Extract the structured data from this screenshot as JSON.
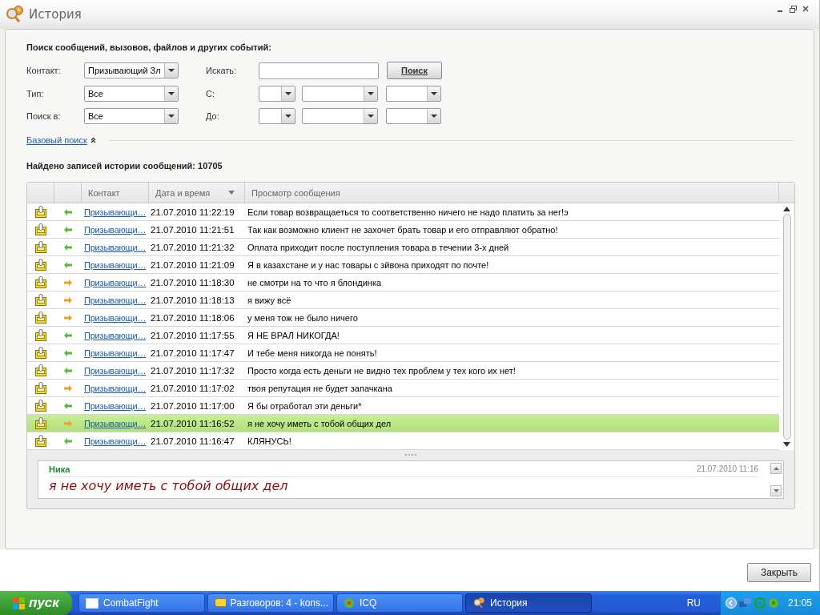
{
  "window": {
    "title": "История"
  },
  "search": {
    "heading": "Поиск сообщений, вызовов, файлов и других событий:",
    "contact_label": "Контакт:",
    "contact_value": "Призывающий Зл",
    "find_label": "Искать:",
    "find_button": "Поиск",
    "type_label": "Тип:",
    "type_value": "Все",
    "from_label": "С:",
    "to_label": "До:",
    "search_in_label": "Поиск в:",
    "search_in_value": "Все",
    "basic_search_link": "Базовый поиск"
  },
  "found_text": "Найдено записей истории сообщений: 10705",
  "table": {
    "columns": [
      "Контакт",
      "Дата и время",
      "Просмотр сообщения"
    ],
    "rows": [
      {
        "kind": "incoming",
        "contact": "Призывающи…",
        "datetime": "21.07.2010 11:22:19",
        "message": "Если товар возвращаеться то соответственно ничего не надо платить за нег!э",
        "selected": false
      },
      {
        "kind": "incoming",
        "contact": "Призывающи…",
        "datetime": "21.07.2010 11:21:51",
        "message": "Так как возможно клиент не захочет брать товар и его отправляют обратно!",
        "selected": false
      },
      {
        "kind": "incoming",
        "contact": "Призывающи…",
        "datetime": "21.07.2010 11:21:32",
        "message": "Оплата приходит после поступления товара в течении 3-х дней",
        "selected": false
      },
      {
        "kind": "incoming",
        "contact": "Призывающи…",
        "datetime": "21.07.2010 11:21:09",
        "message": "Я в казахстане и у нас товары с зйвона приходят по почте!",
        "selected": false
      },
      {
        "kind": "outgoing",
        "contact": "Призывающи…",
        "datetime": "21.07.2010 11:18:30",
        "message": "не смотри на то что я блондинка",
        "selected": false
      },
      {
        "kind": "outgoing",
        "contact": "Призывающи…",
        "datetime": "21.07.2010 11:18:13",
        "message": "я вижу всё",
        "selected": false
      },
      {
        "kind": "outgoing",
        "contact": "Призывающи…",
        "datetime": "21.07.2010 11:18:06",
        "message": "у меня тож не было ничего",
        "selected": false
      },
      {
        "kind": "incoming",
        "contact": "Призывающи…",
        "datetime": "21.07.2010 11:17:55",
        "message": "Я НЕ ВРАЛ НИКОГДА!",
        "selected": false
      },
      {
        "kind": "incoming",
        "contact": "Призывающи…",
        "datetime": "21.07.2010 11:17:47",
        "message": "И тебе меня никогда не понять!",
        "selected": false
      },
      {
        "kind": "incoming",
        "contact": "Призывающи…",
        "datetime": "21.07.2010 11:17:32",
        "message": "Просто когда есть деньги не видно тех проблем у тех кого их нет!",
        "selected": false
      },
      {
        "kind": "outgoing",
        "contact": "Призывающи…",
        "datetime": "21.07.2010 11:17:02",
        "message": "твоя репутация не будет запачкана",
        "selected": false
      },
      {
        "kind": "incoming",
        "contact": "Призывающи…",
        "datetime": "21.07.2010 11:17:00",
        "message": "Я бы отработал эти деньги*",
        "selected": false
      },
      {
        "kind": "outgoing",
        "contact": "Призывающи…",
        "datetime": "21.07.2010 11:16:52",
        "message": "я не хочу иметь с тобой общих дел",
        "selected": true
      },
      {
        "kind": "incoming",
        "contact": "Призывающи…",
        "datetime": "21.07.2010 11:16:47",
        "message": "КЛЯНУСЬ!",
        "selected": false
      }
    ]
  },
  "preview": {
    "sender": "Ника",
    "time": "21.07.2010 11:16",
    "message": "я не хочу иметь с тобой общих дел"
  },
  "close_button": "Закрыть",
  "taskbar": {
    "start": "пуск",
    "tasks": [
      {
        "label": "CombatFight",
        "kind": "window",
        "selected": false
      },
      {
        "label": "Разговоров: 4 - kons...",
        "kind": "chat",
        "selected": false
      },
      {
        "label": "ICQ",
        "kind": "flower",
        "selected": false
      },
      {
        "label": "История",
        "kind": "history",
        "selected": true
      }
    ],
    "language": "RU",
    "clock": "21:05"
  }
}
